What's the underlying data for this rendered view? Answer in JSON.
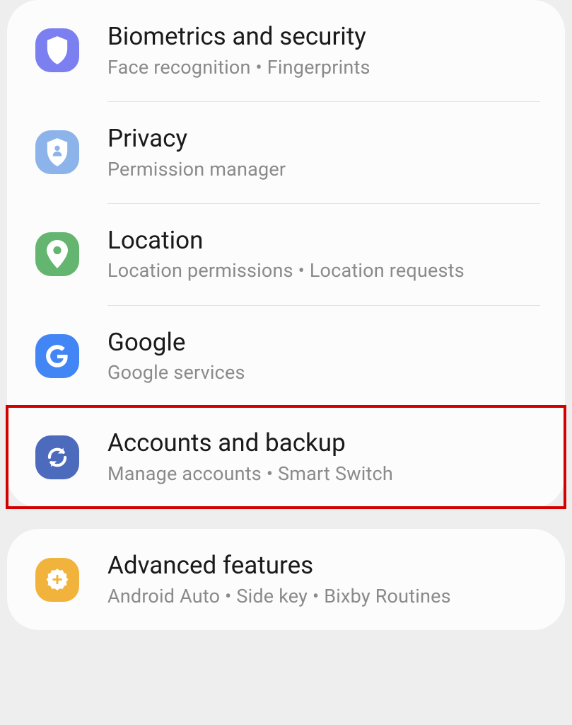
{
  "settings": {
    "group1": [
      {
        "title": "Biometrics and security",
        "subtitle": "Face recognition  •  Fingerprints",
        "icon": "shield-icon",
        "iconBg": "bg-biometrics",
        "highlighted": false
      },
      {
        "title": "Privacy",
        "subtitle": "Permission manager",
        "icon": "privacy-shield-icon",
        "iconBg": "bg-privacy",
        "highlighted": false
      },
      {
        "title": "Location",
        "subtitle": "Location permissions  •  Location requests",
        "icon": "location-pin-icon",
        "iconBg": "bg-location",
        "highlighted": false
      },
      {
        "title": "Google",
        "subtitle": "Google services",
        "icon": "google-g-icon",
        "iconBg": "bg-google",
        "highlighted": false
      },
      {
        "title": "Accounts and backup",
        "subtitle": "Manage accounts  •  Smart Switch",
        "icon": "sync-icon",
        "iconBg": "bg-accounts",
        "highlighted": true
      }
    ],
    "group2": [
      {
        "title": "Advanced features",
        "subtitle": "Android Auto  •  Side key  •  Bixby Routines",
        "icon": "plus-badge-icon",
        "iconBg": "bg-advanced",
        "highlighted": false
      }
    ]
  }
}
